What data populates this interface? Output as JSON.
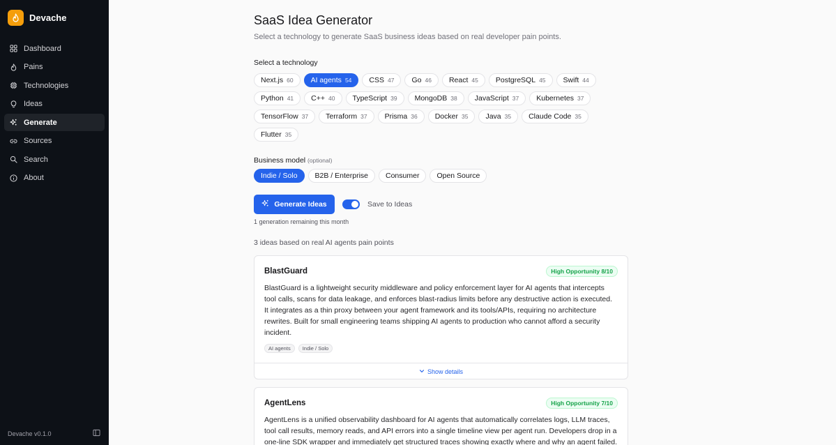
{
  "app": {
    "name": "Devache",
    "version": "Devache v0.1.0"
  },
  "sidebar": {
    "items": [
      {
        "label": "Dashboard",
        "icon": "grid-icon"
      },
      {
        "label": "Pains",
        "icon": "flame-icon"
      },
      {
        "label": "Technologies",
        "icon": "cpu-icon"
      },
      {
        "label": "Ideas",
        "icon": "lightbulb-icon"
      },
      {
        "label": "Generate",
        "icon": "sparkles-icon",
        "active": true
      },
      {
        "label": "Sources",
        "icon": "link-icon"
      },
      {
        "label": "Search",
        "icon": "search-icon"
      },
      {
        "label": "About",
        "icon": "info-icon"
      }
    ]
  },
  "page": {
    "title": "SaaS Idea Generator",
    "subtitle": "Select a technology to generate SaaS business ideas based on real developer pain points."
  },
  "technology": {
    "label": "Select a technology",
    "selected": "AI agents",
    "options": [
      {
        "name": "Next.js",
        "count": "60"
      },
      {
        "name": "AI agents",
        "count": "54"
      },
      {
        "name": "CSS",
        "count": "47"
      },
      {
        "name": "Go",
        "count": "46"
      },
      {
        "name": "React",
        "count": "45"
      },
      {
        "name": "PostgreSQL",
        "count": "45"
      },
      {
        "name": "Swift",
        "count": "44"
      },
      {
        "name": "Python",
        "count": "41"
      },
      {
        "name": "C++",
        "count": "40"
      },
      {
        "name": "TypeScript",
        "count": "39"
      },
      {
        "name": "MongoDB",
        "count": "38"
      },
      {
        "name": "JavaScript",
        "count": "37"
      },
      {
        "name": "Kubernetes",
        "count": "37"
      },
      {
        "name": "TensorFlow",
        "count": "37"
      },
      {
        "name": "Terraform",
        "count": "37"
      },
      {
        "name": "Prisma",
        "count": "36"
      },
      {
        "name": "Docker",
        "count": "35"
      },
      {
        "name": "Java",
        "count": "35"
      },
      {
        "name": "Claude Code",
        "count": "35"
      },
      {
        "name": "Flutter",
        "count": "35"
      }
    ]
  },
  "business_model": {
    "label": "Business model",
    "optional": "(optional)",
    "selected": "Indie / Solo",
    "options": [
      "Indie / Solo",
      "B2B / Enterprise",
      "Consumer",
      "Open Source"
    ]
  },
  "generate": {
    "button_label": "Generate Ideas",
    "save_label": "Save to Ideas",
    "save_enabled": true,
    "remaining": "1 generation remaining this month"
  },
  "results": {
    "summary": "3 ideas based on real AI agents pain points",
    "ideas": [
      {
        "title": "BlastGuard",
        "badge": "High Opportunity 8/10",
        "description": "BlastGuard is a lightweight security middleware and policy enforcement layer for AI agents that intercepts tool calls, scans for data leakage, and enforces blast-radius limits before any destructive action is executed. It integrates as a thin proxy between your agent framework and its tools/APIs, requiring no architecture rewrites. Built for small engineering teams shipping AI agents to production who cannot afford a security incident.",
        "tags": [
          "AI agents",
          "Indie / Solo"
        ],
        "details_label": "Show details"
      },
      {
        "title": "AgentLens",
        "badge": "High Opportunity 7/10",
        "description": "AgentLens is a unified observability dashboard for AI agents that automatically correlates logs, LLM traces, tool call results, memory reads, and API errors into a single timeline view per agent run. Developers drop in a one-line SDK wrapper and immediately get structured traces showing exactly where and why an agent failed."
      }
    ]
  },
  "colors": {
    "accent": "#2563eb",
    "sidebar_bg": "#0d1117",
    "badge_green": "#16a34a",
    "logo": "#f59e0b"
  }
}
